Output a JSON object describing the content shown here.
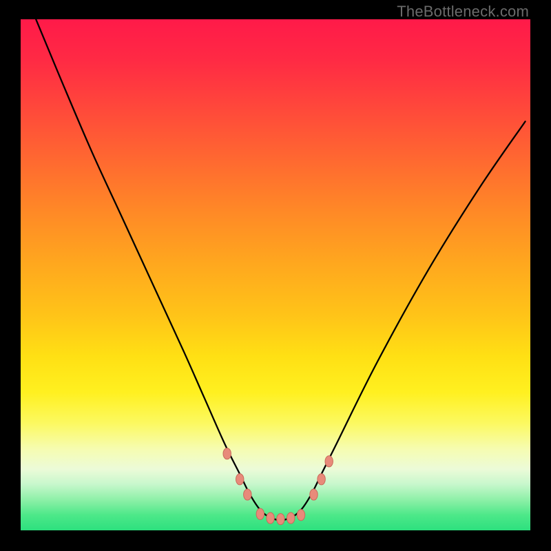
{
  "attribution": "TheBottleneck.com",
  "colors": {
    "black": "#000000",
    "curve": "#000000",
    "marker_fill": "#e88a7a",
    "marker_stroke": "#c96a5a",
    "attribution_text": "#6b6b6b"
  },
  "chart_data": {
    "type": "line",
    "title": "",
    "xlabel": "",
    "ylabel": "",
    "xlim": [
      0,
      100
    ],
    "ylim": [
      0,
      100
    ],
    "grid": false,
    "legend": false,
    "annotations": [],
    "series": [
      {
        "name": "bottleneck-curve",
        "x": [
          3,
          8,
          14,
          20,
          26,
          32,
          36,
          40,
          43,
          45,
          47,
          49,
          51,
          53,
          55,
          57,
          59,
          62,
          70,
          80,
          90,
          99
        ],
        "y": [
          100,
          88,
          74,
          61,
          48,
          35,
          26,
          17,
          11,
          7,
          4,
          2.5,
          2,
          2.5,
          4,
          7,
          11,
          17,
          33,
          51,
          67,
          80
        ]
      }
    ],
    "markers": {
      "name": "bottom-markers",
      "points": [
        {
          "x": 40.5,
          "y": 15,
          "size": 6
        },
        {
          "x": 43,
          "y": 10,
          "size": 6
        },
        {
          "x": 44.5,
          "y": 7,
          "size": 6
        },
        {
          "x": 47,
          "y": 3.2,
          "size": 6
        },
        {
          "x": 49,
          "y": 2.4,
          "size": 6
        },
        {
          "x": 51,
          "y": 2.2,
          "size": 6
        },
        {
          "x": 53,
          "y": 2.4,
          "size": 6
        },
        {
          "x": 55,
          "y": 3,
          "size": 6
        },
        {
          "x": 57.5,
          "y": 7,
          "size": 6
        },
        {
          "x": 59,
          "y": 10,
          "size": 6
        },
        {
          "x": 60.5,
          "y": 13.5,
          "size": 6
        }
      ]
    }
  }
}
